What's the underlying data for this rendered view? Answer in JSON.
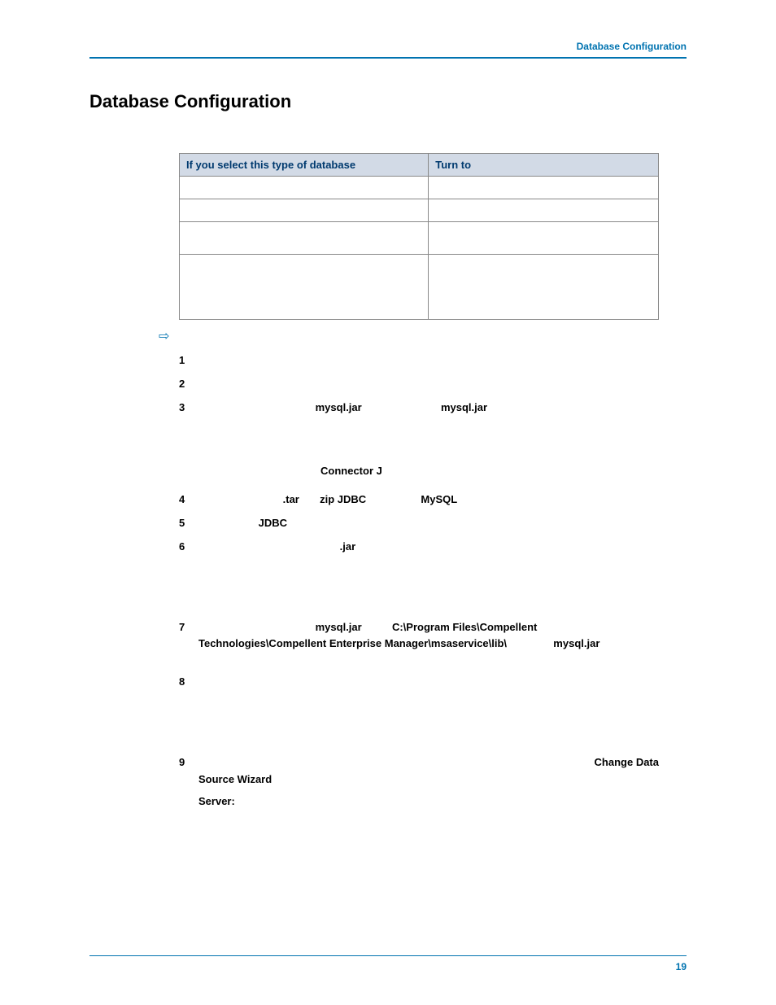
{
  "header": {
    "link_text": "Database Configuration"
  },
  "title": "Database Configuration",
  "table": {
    "col1": "If you select this type of database",
    "col2": "Turn to"
  },
  "connector_label": "Connector J",
  "steps": {
    "s1": "1",
    "s2": "2",
    "s3": {
      "num": "3",
      "t1": "mysql.jar",
      "t2": "mysql.jar"
    },
    "s4": {
      "num": "4",
      "t1": ".tar",
      "t2": "zip JDBC",
      "t3": "MySQL"
    },
    "s5": {
      "num": "5",
      "t1": "JDBC"
    },
    "s6": {
      "num": "6",
      "t1": ".jar"
    },
    "s7": {
      "num": "7",
      "t1": "mysql.jar",
      "t2": "C:\\Program Files\\Compellent Technologies\\Compellent Enterprise Manager\\msaservice\\lib\\",
      "t3": "mysql.jar"
    },
    "s8": "8",
    "s9": {
      "num": "9",
      "t1": "Change Data Source Wizard",
      "t2": "Server:"
    }
  },
  "footer": {
    "page_number": "19"
  }
}
